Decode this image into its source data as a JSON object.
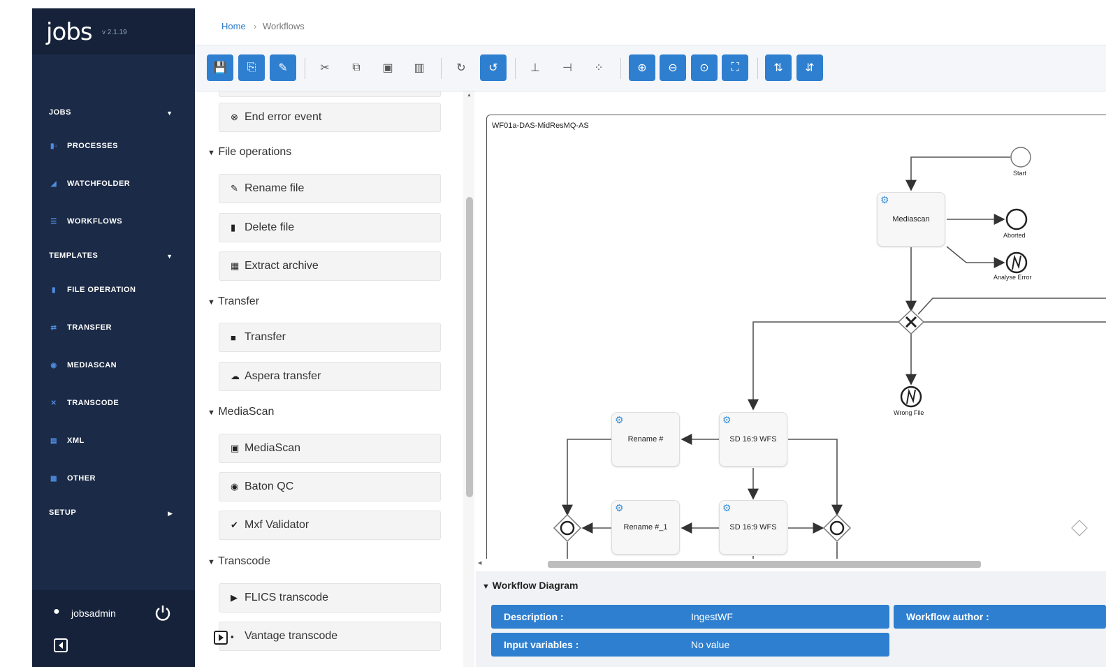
{
  "app": {
    "logo": "jobs",
    "version": "v 2.1.19"
  },
  "sidebar": {
    "sections": [
      {
        "label": "JOBS"
      },
      {
        "label": "TEMPLATES"
      },
      {
        "label": "SETUP"
      }
    ],
    "jobs_items": [
      {
        "label": "PROCESSES",
        "icon": "processes-icon"
      },
      {
        "label": "WATCHFOLDER",
        "icon": "watchfolder-icon"
      },
      {
        "label": "WORKFLOWS",
        "icon": "workflows-icon"
      }
    ],
    "template_items": [
      {
        "label": "FILE OPERATION",
        "icon": "file-icon"
      },
      {
        "label": "TRANSFER",
        "icon": "transfer-icon"
      },
      {
        "label": "MEDIASCAN",
        "icon": "eye-icon"
      },
      {
        "label": "TRANSCODE",
        "icon": "shuffle-icon"
      },
      {
        "label": "XML",
        "icon": "document-icon"
      },
      {
        "label": "OTHER",
        "icon": "grid-icon"
      }
    ],
    "user": "jobsadmin"
  },
  "breadcrumb": {
    "home": "Home",
    "separator": "›",
    "current": "Workflows"
  },
  "palette": {
    "top_item": "End error event",
    "categories": [
      {
        "label": "File operations",
        "items": [
          "Rename file",
          "Delete file",
          "Extract archive"
        ]
      },
      {
        "label": "Transfer",
        "items": [
          "Transfer",
          "Aspera transfer"
        ]
      },
      {
        "label": "MediaScan",
        "items": [
          "MediaScan",
          "Baton QC",
          "Mxf Validator"
        ]
      },
      {
        "label": "Transcode",
        "items": [
          "FLICS transcode",
          "Vantage transcode"
        ]
      }
    ]
  },
  "diagram": {
    "pool_label": "WF01a-DAS-MidResMQ-AS",
    "tasks": [
      "Mediascan",
      "Rename #",
      "SD 16:9 WFS",
      "Rename #_1",
      "SD 16:9 WFS"
    ],
    "events": [
      "Start",
      "Aborted",
      "Analyse Error",
      "Wrong File"
    ]
  },
  "details": {
    "title": "Workflow Diagram",
    "description_label": "Description :",
    "description_value": "IngestWF",
    "author_label": "Workflow author :",
    "input_label": "Input variables :",
    "input_value": "No value"
  },
  "colors": {
    "sidebar": "#1b2a46",
    "accent": "#2f7fd0"
  }
}
